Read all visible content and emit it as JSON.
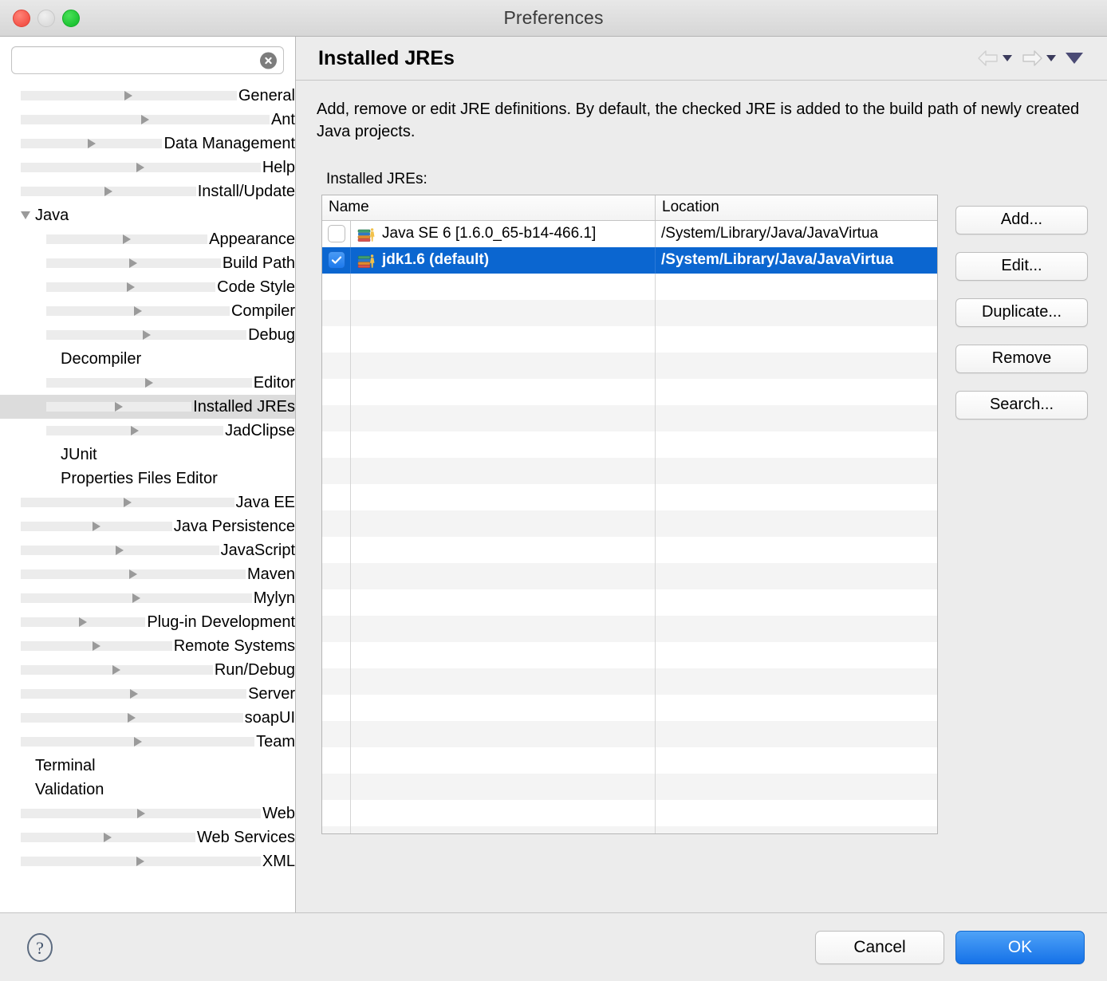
{
  "window": {
    "title": "Preferences",
    "traffic_lights": [
      "close-red",
      "minimize-disabled",
      "zoom-green"
    ]
  },
  "search": {
    "value": "",
    "placeholder": "",
    "clear_icon": "clear-circle-x-icon"
  },
  "sidebar": {
    "items": [
      {
        "label": "General",
        "level": 1,
        "arrow": "right",
        "selected": false
      },
      {
        "label": "Ant",
        "level": 1,
        "arrow": "right",
        "selected": false
      },
      {
        "label": "Data Management",
        "level": 1,
        "arrow": "right",
        "selected": false
      },
      {
        "label": "Help",
        "level": 1,
        "arrow": "right",
        "selected": false
      },
      {
        "label": "Install/Update",
        "level": 1,
        "arrow": "right",
        "selected": false
      },
      {
        "label": "Java",
        "level": 1,
        "arrow": "down",
        "selected": false
      },
      {
        "label": "Appearance",
        "level": 2,
        "arrow": "right",
        "selected": false
      },
      {
        "label": "Build Path",
        "level": 2,
        "arrow": "right",
        "selected": false
      },
      {
        "label": "Code Style",
        "level": 2,
        "arrow": "right",
        "selected": false
      },
      {
        "label": "Compiler",
        "level": 2,
        "arrow": "right",
        "selected": false
      },
      {
        "label": "Debug",
        "level": 2,
        "arrow": "right",
        "selected": false
      },
      {
        "label": "Decompiler",
        "level": 2,
        "arrow": "none",
        "selected": false
      },
      {
        "label": "Editor",
        "level": 2,
        "arrow": "right",
        "selected": false
      },
      {
        "label": "Installed JREs",
        "level": 2,
        "arrow": "right",
        "selected": true
      },
      {
        "label": "JadClipse",
        "level": 2,
        "arrow": "right",
        "selected": false
      },
      {
        "label": "JUnit",
        "level": 2,
        "arrow": "none",
        "selected": false
      },
      {
        "label": "Properties Files Editor",
        "level": 2,
        "arrow": "none",
        "selected": false
      },
      {
        "label": "Java EE",
        "level": 1,
        "arrow": "right",
        "selected": false
      },
      {
        "label": "Java Persistence",
        "level": 1,
        "arrow": "right",
        "selected": false
      },
      {
        "label": "JavaScript",
        "level": 1,
        "arrow": "right",
        "selected": false
      },
      {
        "label": "Maven",
        "level": 1,
        "arrow": "right",
        "selected": false
      },
      {
        "label": "Mylyn",
        "level": 1,
        "arrow": "right",
        "selected": false
      },
      {
        "label": "Plug-in Development",
        "level": 1,
        "arrow": "right",
        "selected": false
      },
      {
        "label": "Remote Systems",
        "level": 1,
        "arrow": "right",
        "selected": false
      },
      {
        "label": "Run/Debug",
        "level": 1,
        "arrow": "right",
        "selected": false
      },
      {
        "label": "Server",
        "level": 1,
        "arrow": "right",
        "selected": false
      },
      {
        "label": "soapUI",
        "level": 1,
        "arrow": "right",
        "selected": false
      },
      {
        "label": "Team",
        "level": 1,
        "arrow": "right",
        "selected": false
      },
      {
        "label": "Terminal",
        "level": 1,
        "arrow": "none",
        "selected": false
      },
      {
        "label": "Validation",
        "level": 1,
        "arrow": "none",
        "selected": false
      },
      {
        "label": "Web",
        "level": 1,
        "arrow": "right",
        "selected": false
      },
      {
        "label": "Web Services",
        "level": 1,
        "arrow": "right",
        "selected": false
      },
      {
        "label": "XML",
        "level": 1,
        "arrow": "right",
        "selected": false
      }
    ]
  },
  "page": {
    "title": "Installed JREs",
    "nav": {
      "back_icon": "back-arrow-icon",
      "back_caret_icon": "chevron-down-icon",
      "forward_icon": "forward-arrow-icon",
      "forward_caret_icon": "chevron-down-icon",
      "menu_icon": "chevron-down-icon"
    },
    "description": "Add, remove or edit JRE definitions. By default, the checked JRE is added to the build path of newly created Java projects.",
    "table_label": "Installed JREs:"
  },
  "table": {
    "columns": [
      "Name",
      "Location"
    ],
    "rows": [
      {
        "checked": false,
        "icon": "jre-books-icon",
        "name": "Java SE 6 [1.6.0_65-b14-466.1]",
        "location": "/System/Library/Java/JavaVirtua",
        "selected": false
      },
      {
        "checked": true,
        "icon": "jre-books-icon",
        "name": "jdk1.6 (default)",
        "location": "/System/Library/Java/JavaVirtua",
        "selected": true
      }
    ],
    "empty_row_count": 22,
    "selection_color": "#0b66d0"
  },
  "side_buttons": [
    {
      "label": "Add...",
      "name": "add-button"
    },
    {
      "label": "Edit...",
      "name": "edit-button"
    },
    {
      "label": "Duplicate...",
      "name": "duplicate-button"
    },
    {
      "label": "Remove",
      "name": "remove-button"
    },
    {
      "label": "Search...",
      "name": "search-jre-button"
    }
  ],
  "footer": {
    "help_icon": "help-question-icon",
    "cancel_label": "Cancel",
    "ok_label": "OK",
    "ok_color": "#1572e8"
  }
}
